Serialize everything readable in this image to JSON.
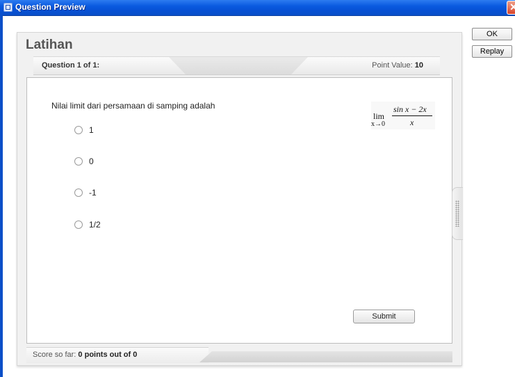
{
  "window": {
    "title": "Question Preview",
    "close_glyph": "✕"
  },
  "dialog": {
    "ok_label": "OK",
    "replay_label": "Replay"
  },
  "quiz": {
    "title": "Latihan",
    "question_counter": "Question 1 of 1:",
    "point_value_label": "Point Value:",
    "point_value": "10",
    "question_text": "Nilai limit dari persamaan di samping adalah",
    "formula": {
      "lim": "lim",
      "sub": "x→0",
      "numerator": "sin x − 2x",
      "denominator": "x"
    },
    "options": [
      {
        "label": "1",
        "selected": false
      },
      {
        "label": "0",
        "selected": false
      },
      {
        "label": "-1",
        "selected": false
      },
      {
        "label": "1/2",
        "selected": false
      }
    ],
    "submit_label": "Submit",
    "score_label": "Score so far:",
    "score_value": "0 points out of 0"
  },
  "colors": {
    "titlebar": "#0a5ae0",
    "panel": "#f1f1f1",
    "close": "#d8452c"
  }
}
